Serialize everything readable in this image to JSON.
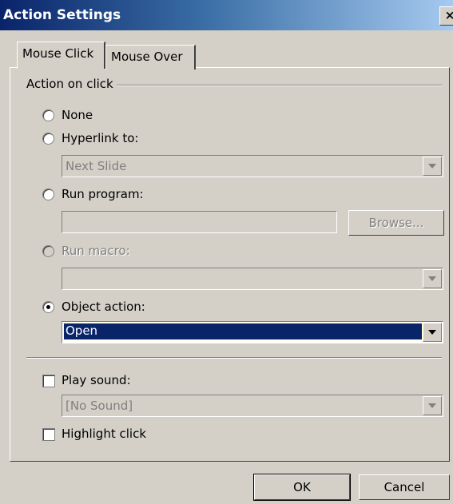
{
  "window": {
    "title": "Action Settings",
    "close_glyph": "×"
  },
  "tabs": [
    {
      "label": "Mouse Click",
      "active": true
    },
    {
      "label": "Mouse Over",
      "active": false
    }
  ],
  "group": {
    "label": "Action on click"
  },
  "options": {
    "none": {
      "label": "None",
      "selected": false,
      "enabled": true
    },
    "hyperlink": {
      "label": "Hyperlink to:",
      "selected": false,
      "enabled": true,
      "value": "Next Slide"
    },
    "run_program": {
      "label": "Run program:",
      "selected": false,
      "enabled": true,
      "value": "",
      "browse_label": "Browse..."
    },
    "run_macro": {
      "label": "Run macro:",
      "selected": false,
      "enabled": false,
      "value": ""
    },
    "object_action": {
      "label": "Object action:",
      "selected": true,
      "enabled": true,
      "value": "Open"
    }
  },
  "sound": {
    "label": "Play sound:",
    "checked": false,
    "value": "[No Sound]"
  },
  "highlight": {
    "label": "Highlight click",
    "checked": false
  },
  "buttons": {
    "ok": "OK",
    "cancel": "Cancel"
  },
  "colors": {
    "face": "#d4d0c8",
    "title_start": "#0a246a",
    "title_end": "#a6caf0",
    "selection": "#0a246a"
  },
  "icons": {
    "dropdown": "chevron-down-icon"
  }
}
